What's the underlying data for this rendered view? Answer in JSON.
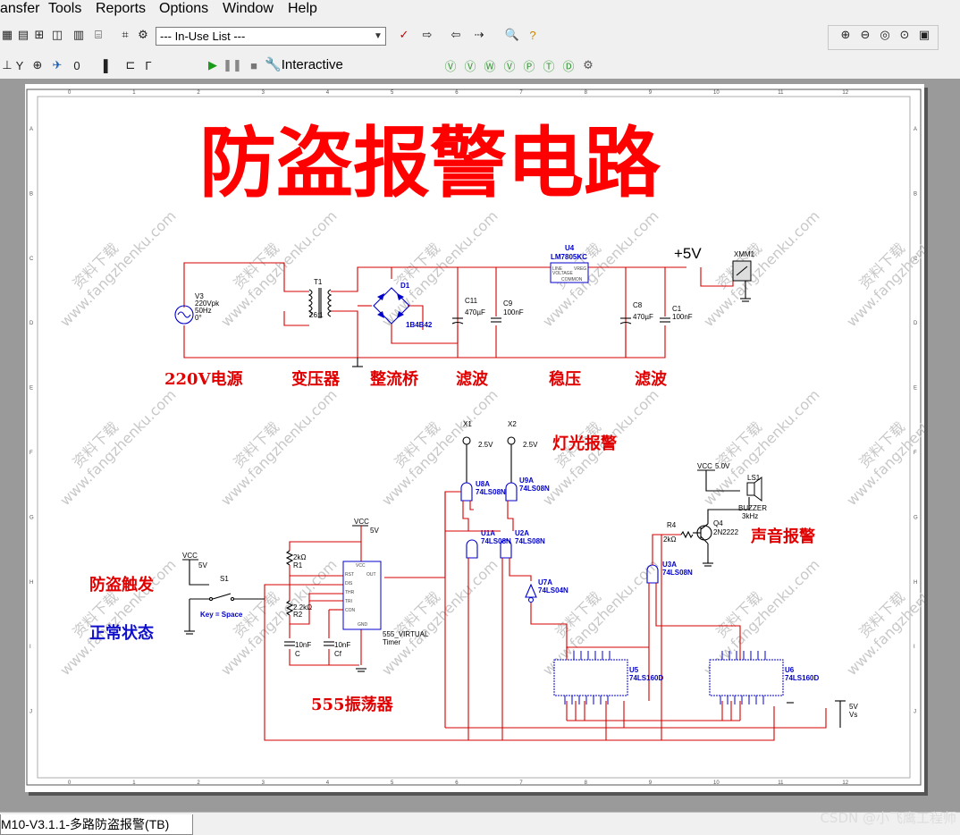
{
  "menu": {
    "items": [
      "ansfer",
      "Tools",
      "Reports",
      "Options",
      "Window",
      "Help"
    ]
  },
  "toolbar": {
    "in_use_list": "--- In-Use List ---",
    "mode_label": "Interactive"
  },
  "tab": {
    "name": "M10-V3.1.1-多路防盗报警(TB)"
  },
  "watermark": {
    "cn": "资料下载",
    "url": "www.fangzhenku.com",
    "csdn": "CSDN @小飞鹰工程师"
  },
  "sheet": {
    "title": "防盗报警电路",
    "col_labels": [
      "0",
      "1",
      "2",
      "3",
      "4",
      "5",
      "6",
      "7",
      "8",
      "9",
      "10",
      "11",
      "12"
    ],
    "row_labels": [
      "A",
      "B",
      "C",
      "D",
      "E",
      "F",
      "G",
      "H",
      "I",
      "J"
    ]
  },
  "psu": {
    "v3": [
      "V3",
      "220Vpk",
      "50Hz",
      "0°"
    ],
    "t1": "T1",
    "t1_ratio": "26:1",
    "d1": "D1",
    "d1_part": "1B4B42",
    "c11": "C11",
    "c11_val": "470µF",
    "c9": "C9",
    "c9_val": "100nF",
    "u4": "U4",
    "u4_part": "LM7805KC",
    "u4_pins": [
      "LINE",
      "VREG",
      "VOLTAGE",
      "COMMON"
    ],
    "c8": "C8",
    "c8_val": "470µF",
    "c1": "C1",
    "c1_val": "100nF",
    "plus5": "+5V",
    "xmm": "XMM1"
  },
  "sections": {
    "power": "220V电源",
    "transformer": "变压器",
    "bridge": "整流桥",
    "filter1": "滤波",
    "regulator": "稳压",
    "filter2": "滤波",
    "light_alarm": "灯光报警",
    "sound_alarm": "声音报警",
    "trigger": "防盗触发",
    "normal": "正常状态",
    "oscillator": "555振荡器"
  },
  "alarm": {
    "x1": "X1",
    "x2": "X2",
    "lamp_v": "2.5V",
    "u8a": "U8A",
    "u9a": "U9A",
    "u1a": "U1A",
    "u2a": "U2A",
    "and_part": "74LS08N",
    "u7a": "U7A",
    "u7a_part": "74LS04N",
    "vcc_label": "VCC",
    "vcc_v": "5.0V",
    "ls1": "LS1",
    "buzzer": "BUZZER",
    "buzzer_f": "3kHz",
    "r4": "R4",
    "r4_val": "2kΩ",
    "q4": "Q4",
    "q4_part": "2N2222",
    "u3a": "U3A",
    "u3a_part": "74LS08N",
    "u5": "U5",
    "u5_part": "74LS160D",
    "u6": "U6",
    "u6_part": "74LS160D",
    "vs_v": "5V",
    "vs": "Vs"
  },
  "timer": {
    "vcc": "VCC",
    "vcc_v": "5V",
    "vcc2": "VCC",
    "vcc2_v": "5V",
    "s1": "S1",
    "key": "Key = Space",
    "r1": "R1",
    "r1_val": "2kΩ",
    "r2": "R2",
    "r2_val": "2.2kΩ",
    "c": "C",
    "c_val": "10nF",
    "cf": "Cf",
    "cf_val": "10nF",
    "part": "555_VIRTUAL",
    "timer": "Timer",
    "pins_left": [
      "RST",
      "DIS",
      "THR",
      "TRI",
      "CON"
    ],
    "pin_vcc": "VCC",
    "pin_out": "OUT",
    "pin_gnd": "GND"
  },
  "colors": {
    "wire": "#d40000",
    "component": "#0000cc",
    "title_red": "#ff0000",
    "label_red": "#e00000",
    "label_blue": "#1010cc",
    "sheet_bg": "#ffffff",
    "canvas_bg": "#9a9a9a"
  }
}
